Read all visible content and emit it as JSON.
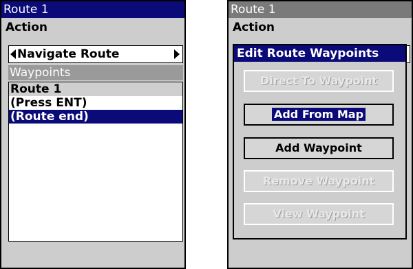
{
  "left": {
    "title": "Route 1",
    "action_label": "Action",
    "action_value": "Navigate Route",
    "waypoints_label": "Waypoints",
    "waypoints": [
      "Route 1",
      "(Press ENT)",
      "(Route end)"
    ]
  },
  "right": {
    "title": "Route 1",
    "action_label": "Action",
    "dialog": {
      "title": "Edit Route Waypoints",
      "buttons": [
        {
          "label": "Direct To Waypoint",
          "state": "disabled"
        },
        {
          "label": "Add From Map",
          "state": "selected"
        },
        {
          "label": "Add Waypoint",
          "state": "enabled"
        },
        {
          "label": "Remove Waypoint",
          "state": "disabled"
        },
        {
          "label": "View Waypoint",
          "state": "disabled"
        }
      ]
    }
  },
  "colors": {
    "title_active": "#0a0a78",
    "title_inactive": "#7a7a7a",
    "panel_bg": "#cdcdcd"
  }
}
